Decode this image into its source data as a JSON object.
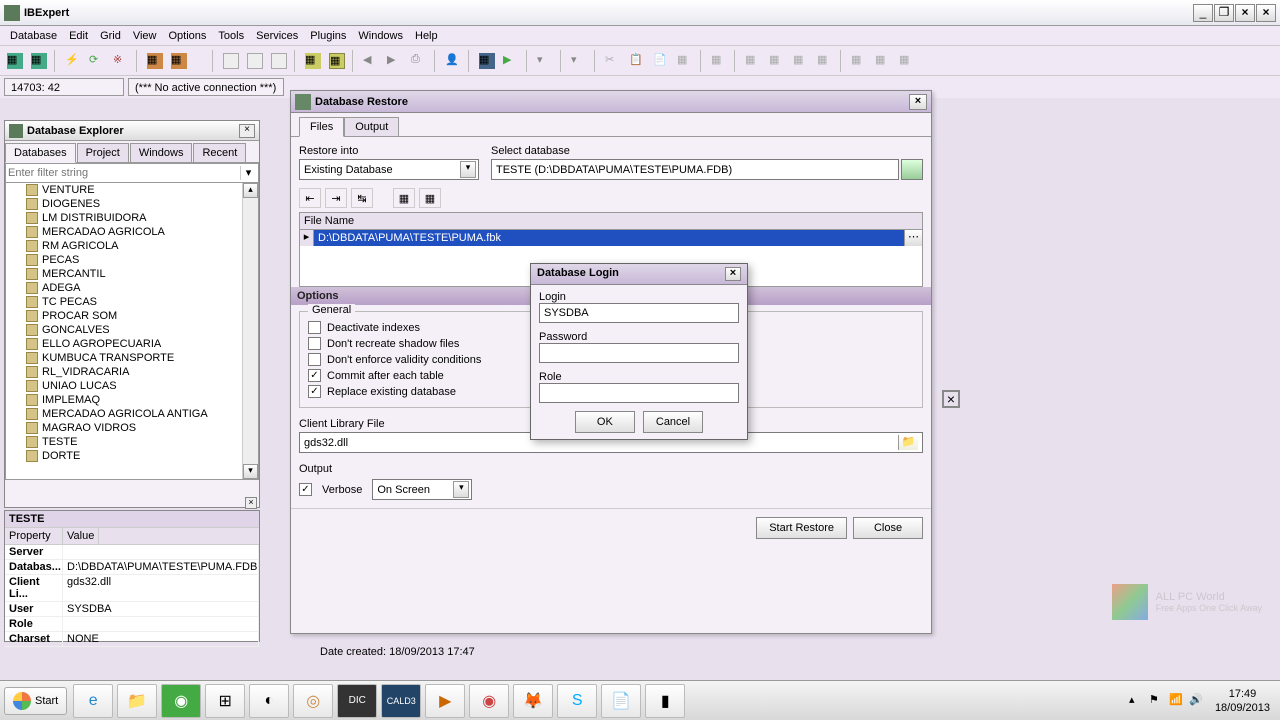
{
  "app": {
    "title": "IBExpert"
  },
  "menu": [
    "Database",
    "Edit",
    "Grid",
    "View",
    "Options",
    "Tools",
    "Services",
    "Plugins",
    "Windows",
    "Help"
  ],
  "status": {
    "pos": "14703: 42",
    "conn": "(*** No active connection ***)"
  },
  "explorer": {
    "title": "Database Explorer",
    "tabs": [
      "Databases",
      "Project",
      "Windows",
      "Recent"
    ],
    "filter_placeholder": "Enter filter string",
    "items": [
      "VENTURE",
      "DIOGENES",
      "LM DISTRIBUIDORA",
      "MERCADAO AGRICOLA",
      "RM AGRICOLA",
      "PECAS",
      "MERCANTIL",
      "ADEGA",
      "TC PECAS",
      "PROCAR SOM",
      "GONCALVES",
      "ELLO AGROPECUARIA",
      "KUMBUCA TRANSPORTE",
      "RL_VIDRACARIA",
      "UNIAO LUCAS",
      "IMPLEMAQ",
      "MERCADAO AGRICOLA ANTIGA",
      "MAGRAO VIDROS",
      "TESTE",
      "DORTE"
    ]
  },
  "props": {
    "title": "TESTE",
    "hdr_prop": "Property",
    "hdr_val": "Value",
    "rows": [
      {
        "k": "Server",
        "v": ""
      },
      {
        "k": "Databas...",
        "v": "D:\\DBDATA\\PUMA\\TESTE\\PUMA.FDB"
      },
      {
        "k": "Client Li...",
        "v": "gds32.dll"
      },
      {
        "k": "User",
        "v": "SYSDBA"
      },
      {
        "k": "Role",
        "v": ""
      },
      {
        "k": "Charset",
        "v": "NONE"
      }
    ]
  },
  "restore": {
    "title": "Database Restore",
    "tabs": [
      "Files",
      "Output"
    ],
    "restore_into_label": "Restore into",
    "restore_into_value": "Existing Database",
    "select_db_label": "Select database",
    "select_db_value": "TESTE (D:\\DBDATA\\PUMA\\TESTE\\PUMA.FDB)",
    "file_hdr": "File Name",
    "file_value": "D:\\DBDATA\\PUMA\\TESTE\\PUMA.fbk",
    "options_label": "Options",
    "general_label": "General",
    "opts": [
      {
        "label": "Deactivate indexes",
        "checked": false
      },
      {
        "label": "Don't recreate shadow files",
        "checked": false
      },
      {
        "label": "Don't enforce validity conditions",
        "checked": false
      },
      {
        "label": "Commit after each table",
        "checked": true
      },
      {
        "label": "Replace existing database",
        "checked": true
      }
    ],
    "client_lib_label": "Client Library File",
    "client_lib_value": "gds32.dll",
    "output_label": "Output",
    "verbose_label": "Verbose",
    "output_mode": "On Screen",
    "btn_start": "Start Restore",
    "btn_close": "Close"
  },
  "login": {
    "title": "Database Login",
    "login_label": "Login",
    "login_value": "SYSDBA",
    "password_label": "Password",
    "password_value": "",
    "role_label": "Role",
    "role_value": "",
    "btn_ok": "OK",
    "btn_cancel": "Cancel"
  },
  "date_created": "Date created:  18/09/2013 17:47",
  "taskbar": {
    "start": "Start",
    "time": "17:49",
    "date": "18/09/2013"
  },
  "watermark": {
    "main": "ALL PC World",
    "sub": "Free Apps One Click Away"
  }
}
